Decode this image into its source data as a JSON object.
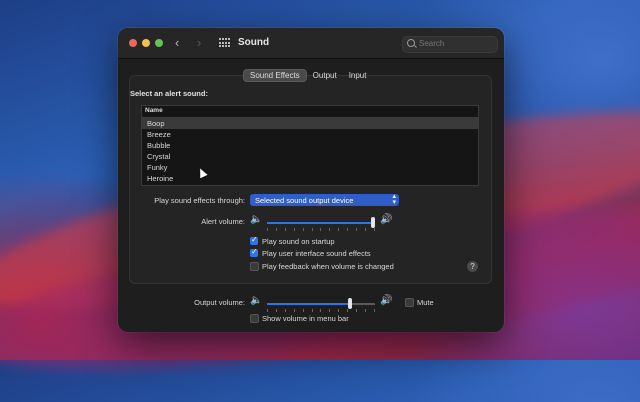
{
  "window": {
    "title": "Sound"
  },
  "search": {
    "placeholder": "Search"
  },
  "tabs": [
    {
      "label": "Sound Effects",
      "active": true
    },
    {
      "label": "Output",
      "active": false
    },
    {
      "label": "Input",
      "active": false
    }
  ],
  "alert_section": {
    "label": "Select an alert sound:",
    "column_header": "Name",
    "sounds": [
      "Boop",
      "Breeze",
      "Bubble",
      "Crystal",
      "Funky",
      "Heroine"
    ],
    "selected": "Boop"
  },
  "play_through": {
    "label": "Play sound effects through:",
    "value": "Selected sound output device"
  },
  "alert_volume": {
    "label": "Alert volume:",
    "level": 1.0
  },
  "checkboxes": [
    {
      "label": "Play sound on startup",
      "checked": true
    },
    {
      "label": "Play user interface sound effects",
      "checked": true
    },
    {
      "label": "Play feedback when volume is changed",
      "checked": false
    }
  ],
  "output_volume": {
    "label": "Output volume:",
    "level": 0.78
  },
  "mute": {
    "label": "Mute",
    "checked": false
  },
  "menu_bar": {
    "label": "Show volume in menu bar",
    "checked": false
  },
  "help": {
    "label": "?"
  },
  "colors": {
    "accent": "#2f74e6",
    "popup": "#2f5ec9"
  }
}
